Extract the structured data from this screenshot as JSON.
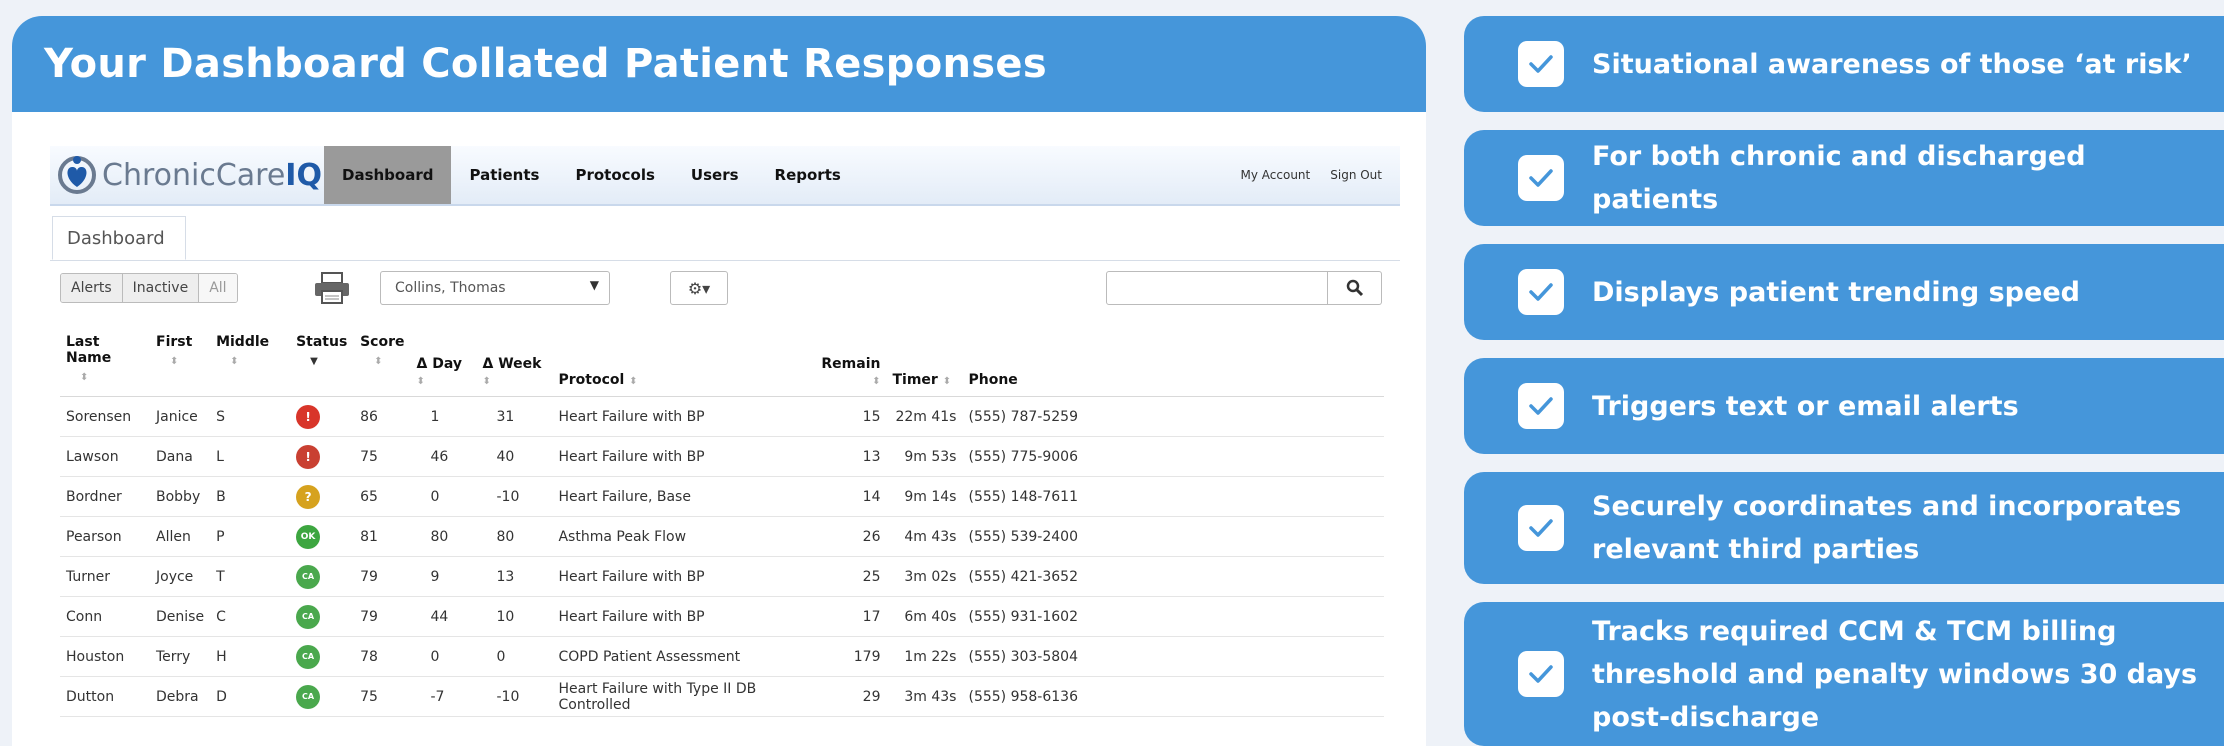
{
  "header": {
    "title": "Your Dashboard Collated Patient Responses"
  },
  "app": {
    "logo_prefix": "ChronicCare",
    "logo_suffix": "IQ",
    "nav": [
      "Dashboard",
      "Patients",
      "Protocols",
      "Users",
      "Reports"
    ],
    "my_account": "My Account",
    "sign_out": "Sign Out",
    "tab": "Dashboard",
    "filters": [
      "Alerts",
      "Inactive",
      "All"
    ],
    "patient_select": "Collins, Thomas",
    "search_placeholder": ""
  },
  "table": {
    "headers": [
      "Last Name",
      "First",
      "Middle",
      "Status",
      "Score",
      "Δ Day",
      "Δ Week",
      "Protocol",
      "Remain",
      "Timer",
      "Phone"
    ],
    "rows": [
      {
        "last": "Sorensen",
        "first": "Janice",
        "middle": "S",
        "status": "alert",
        "score": "86",
        "day": "1",
        "week": "31",
        "protocol": "Heart Failure with BP",
        "remain": "15",
        "timer": "22m 41s",
        "phone": "(555) 787-5259"
      },
      {
        "last": "Lawson",
        "first": "Dana",
        "middle": "L",
        "status": "warning",
        "score": "75",
        "day": "46",
        "week": "40",
        "protocol": "Heart Failure with BP",
        "remain": "13",
        "timer": "9m 53s",
        "phone": "(555) 775-9006"
      },
      {
        "last": "Bordner",
        "first": "Bobby",
        "middle": "B",
        "status": "question",
        "score": "65",
        "day": "0",
        "week": "-10",
        "protocol": "Heart Failure, Base",
        "remain": "14",
        "timer": "9m 14s",
        "phone": "(555) 148-7611"
      },
      {
        "last": "Pearson",
        "first": "Allen",
        "middle": "P",
        "status": "ok",
        "score": "81",
        "day": "80",
        "week": "80",
        "protocol": "Asthma Peak Flow",
        "remain": "26",
        "timer": "4m 43s",
        "phone": "(555) 539-2400"
      },
      {
        "last": "Turner",
        "first": "Joyce",
        "middle": "T",
        "status": "ca",
        "score": "79",
        "day": "9",
        "week": "13",
        "protocol": "Heart Failure with BP",
        "remain": "25",
        "timer": "3m 02s",
        "phone": "(555) 421-3652"
      },
      {
        "last": "Conn",
        "first": "Denise",
        "middle": "C",
        "status": "ca",
        "score": "79",
        "day": "44",
        "week": "10",
        "protocol": "Heart Failure with BP",
        "remain": "17",
        "timer": "6m 40s",
        "phone": "(555) 931-1602"
      },
      {
        "last": "Houston",
        "first": "Terry",
        "middle": "H",
        "status": "ca",
        "score": "78",
        "day": "0",
        "week": "0",
        "protocol": "COPD Patient Assessment",
        "remain": "179",
        "timer": "1m 22s",
        "phone": "(555) 303-5804"
      },
      {
        "last": "Dutton",
        "first": "Debra",
        "middle": "D",
        "status": "ca",
        "score": "75",
        "day": "-7",
        "week": "-10",
        "protocol": "Heart Failure with Type II DB Controlled",
        "remain": "29",
        "timer": "3m 43s",
        "phone": "(555) 958-6136"
      }
    ]
  },
  "status_glyphs": {
    "alert": "!",
    "warning": "!",
    "question": "?",
    "ok": "OK",
    "ca": "CA"
  },
  "features": [
    "Situational awareness of those ‘at risk’",
    "For both chronic and discharged patients",
    "Displays patient trending speed",
    "Triggers text or email alerts",
    "Securely coordinates and incorporates relevant third parties",
    "Tracks required CCM & TCM billing threshold and penalty windows 30 days post-discharge"
  ],
  "colors": {
    "accent": "#4596da",
    "link": "#4a78b8",
    "nav_active": "#9a9a9a"
  }
}
